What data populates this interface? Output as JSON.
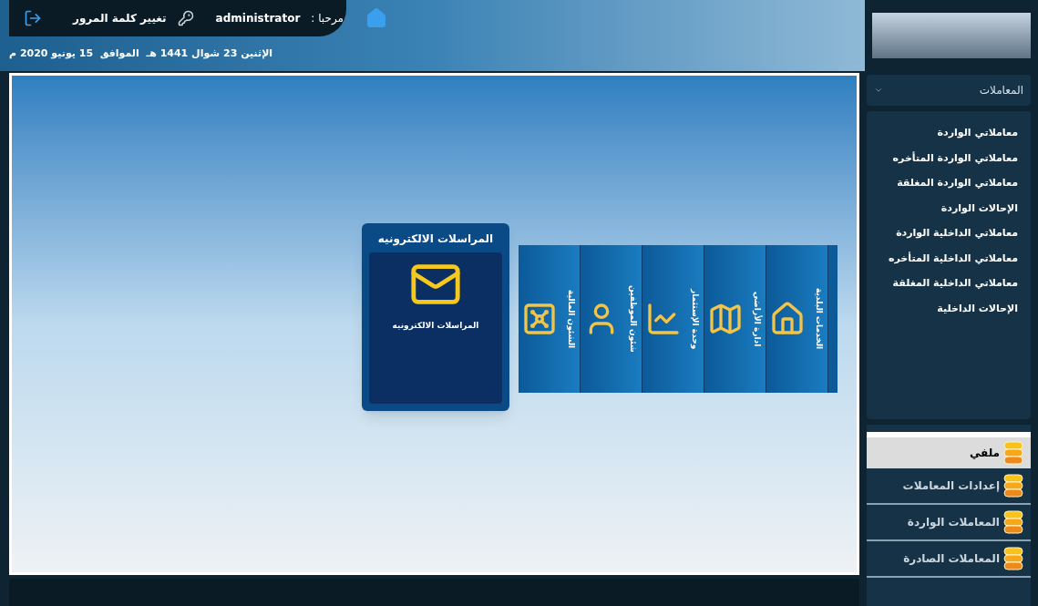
{
  "header": {
    "welcome": "مرحبا :",
    "user": "administrator",
    "change_password": "تغيير كلمة المرور",
    "date": "الإثنين 23 شوال 1441 هـ  الموافق  15 يونيو 2020 م"
  },
  "featured_module": {
    "title": "المراسلات الالكترونيه",
    "label": "المراسلات الالكترونيه"
  },
  "modules": [
    {
      "label": "الشئون المالية",
      "kind": "vault"
    },
    {
      "label": "شئون الموظفين",
      "kind": "person"
    },
    {
      "label": "وحدة الإستثمار",
      "kind": "chart"
    },
    {
      "label": "ادارة الأراضي",
      "kind": "map"
    },
    {
      "label": "الخدمات البلدية",
      "kind": "house"
    }
  ],
  "sidebar": {
    "dropdown": "المعاملات",
    "links": [
      "معاملاتي الواردة",
      "معاملاتي الواردة المتأخره",
      "معاملاتي الواردة المغلقة",
      "الإحالات الواردة",
      "معاملاتي الداخلية الواردة",
      "معاملاتي الداخلية المتأخره",
      "معاملاتي الداخلية المغلقة",
      "الإحالات الداخلية"
    ],
    "sections": [
      {
        "label": "ملفي",
        "selected": true
      },
      {
        "label": "إعدادات المعاملات",
        "selected": false
      },
      {
        "label": "المعاملات الواردة",
        "selected": false
      },
      {
        "label": "المعاملات الصادرة",
        "selected": false
      }
    ]
  }
}
